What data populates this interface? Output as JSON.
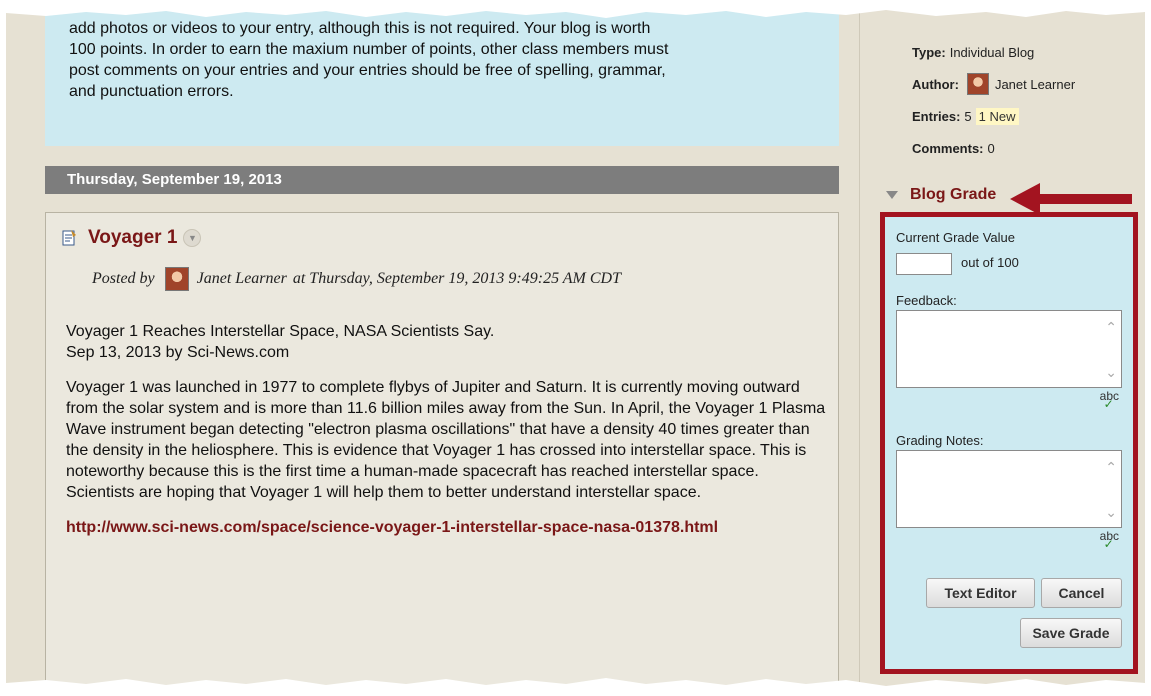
{
  "instructions": {
    "line1": "add photos or videos to your entry, although this is not required. Your blog is worth",
    "line2": "100 points. In order to earn the maxium number of points, other class members must",
    "line3": "post comments on your entries and your entries should be free of spelling, grammar,",
    "line4": "and punctuation errors."
  },
  "date_bar": "Thursday, September 19, 2013",
  "entry": {
    "title": "Voyager 1",
    "posted_by_label": "Posted by",
    "author": "Janet Learner",
    "posted_at": "at Thursday, September 19, 2013 9:49:25 AM CDT",
    "headline_line1": "Voyager 1 Reaches Interstellar Space, NASA Scientists Say.",
    "headline_line2": "Sep 13, 2013 by Sci-News.com",
    "body": "Voyager 1 was launched in 1977 to complete flybys of Jupiter and Saturn. It is currently moving outward from the solar system and is more than 11.6 billion miles away from the Sun. In April, the Voyager 1 Plasma Wave instrument began detecting \"electron plasma oscillations\" that have a density 40 times greater than the density in the heliosphere. This is evidence that Voyager 1 has crossed into interstellar space. This is noteworthy because this is the first time a human-made spacecraft has reached interstellar space. Scientists are hoping that Voyager 1 will help them to better understand interstellar space.",
    "link": "http://www.sci-news.com/space/science-voyager-1-interstellar-space-nasa-01378.html"
  },
  "sidebar": {
    "type_label": "Type:",
    "type_value": "Individual Blog",
    "author_label": "Author:",
    "author_value": "Janet Learner",
    "entries_label": "Entries:",
    "entries_value": "5",
    "entries_new": "1 New",
    "comments_label": "Comments:",
    "comments_value": "0"
  },
  "blog_grade": {
    "title": "Blog Grade",
    "current_grade_label": "Current Grade Value",
    "current_grade_value": "",
    "out_of": "out of 100",
    "feedback_label": "Feedback:",
    "grading_notes_label": "Grading Notes:",
    "spell_label": "abc",
    "text_editor_button": "Text Editor",
    "cancel_button": "Cancel",
    "save_button": "Save Grade"
  },
  "colors": {
    "accent": "#7a1717",
    "highlight_border": "#a31420",
    "instruction_bg": "#cdeaf1",
    "date_bar_bg": "#7d7d7d",
    "page_bg": "#e6e1d3"
  }
}
